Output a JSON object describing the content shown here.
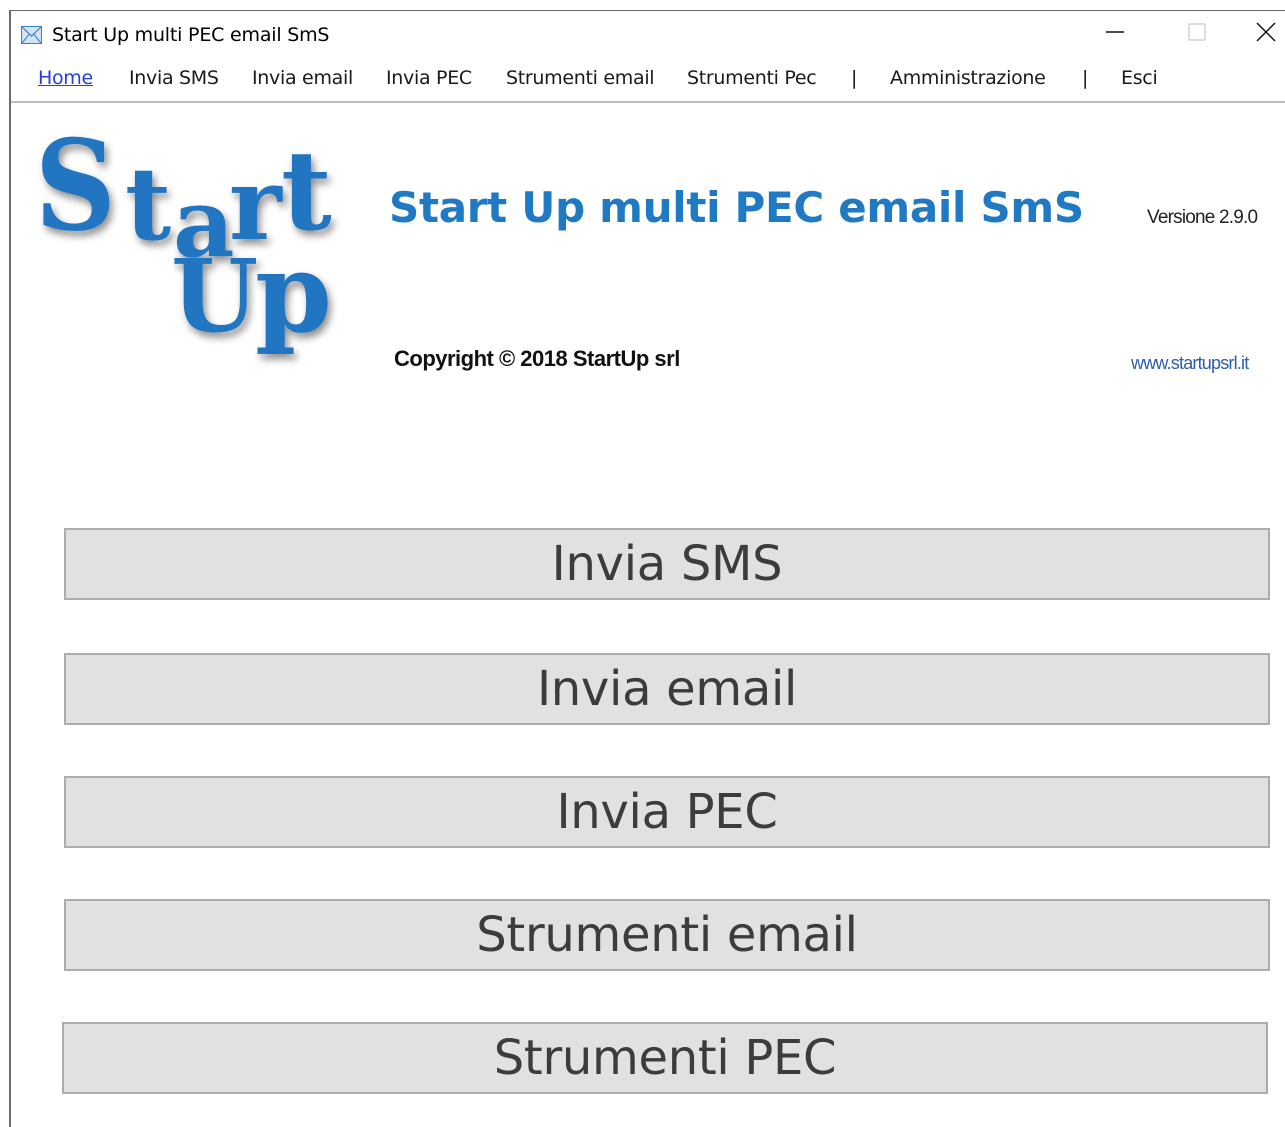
{
  "window": {
    "title": "Start Up multi PEC email SmS",
    "app_icon": "envelope-icon",
    "controls": [
      "minimize-icon",
      "maximize-icon",
      "close-icon"
    ]
  },
  "menu": {
    "items": [
      {
        "label": "Home",
        "active": true
      },
      {
        "label": "Invia SMS"
      },
      {
        "label": "Invia email"
      },
      {
        "label": "Invia PEC"
      },
      {
        "label": "Strumenti email"
      },
      {
        "label": "Strumenti Pec"
      },
      {
        "label": "Amministrazione"
      },
      {
        "label": "Esci"
      }
    ],
    "separator": "|"
  },
  "header": {
    "logo_text": "StartUp",
    "title": "Start Up multi PEC email SmS",
    "version": "Versione 2.9.0",
    "copyright": "Copyright © 2018 StartUp srl",
    "website": "www.startupsrl.it"
  },
  "buttons": [
    {
      "label": "Invia SMS"
    },
    {
      "label": "Invia email"
    },
    {
      "label": "Invia PEC"
    },
    {
      "label": "Strumenti email"
    },
    {
      "label": "Strumenti PEC"
    }
  ],
  "colors": {
    "brand_blue": "#1f7ac3",
    "active_menu": "#2540d9",
    "button_bg": "#e1e1e1"
  }
}
